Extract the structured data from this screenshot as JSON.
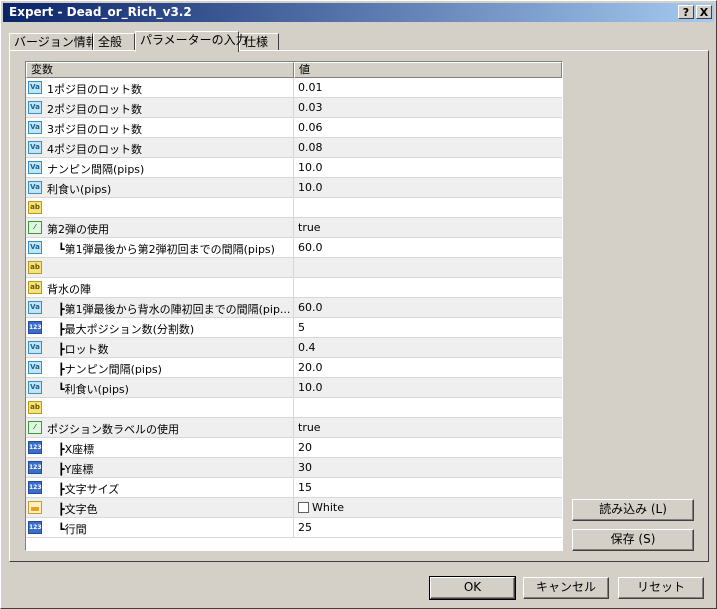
{
  "window": {
    "title": "Expert - Dead_or_Rich_v3.2",
    "help": "?",
    "close": "X"
  },
  "tabs": [
    {
      "label": "バージョン情報"
    },
    {
      "label": "全般"
    },
    {
      "label": "パラメーターの入力"
    },
    {
      "label": "仕様"
    }
  ],
  "grid": {
    "headers": {
      "name": "変数",
      "value": "値"
    },
    "rows": [
      {
        "icon": "va-icon",
        "name": "1ポジ目のロット数",
        "value": "0.01"
      },
      {
        "icon": "va-icon",
        "name": "2ポジ目のロット数",
        "value": "0.03"
      },
      {
        "icon": "va-icon",
        "name": "3ポジ目のロット数",
        "value": "0.06"
      },
      {
        "icon": "va-icon",
        "name": "4ポジ目のロット数",
        "value": "0.08"
      },
      {
        "icon": "va-icon",
        "name": "ナンピン間隔(pips)",
        "value": "10.0"
      },
      {
        "icon": "va-icon",
        "name": "利食い(pips)",
        "value": "10.0"
      },
      {
        "icon": "ab-icon",
        "name": "",
        "value": ""
      },
      {
        "icon": "bool-icon",
        "name": "第2弾の使用",
        "value": "true"
      },
      {
        "icon": "va-icon",
        "name": "┗第1弾最後から第2弾初回までの間隔(pips)",
        "value": "60.0"
      },
      {
        "icon": "ab-icon",
        "name": "",
        "value": ""
      },
      {
        "icon": "ab-icon",
        "name": "背水の陣",
        "value": ""
      },
      {
        "icon": "va-icon",
        "name": "┣第1弾最後から背水の陣初回までの間隔(pip...",
        "value": "60.0"
      },
      {
        "icon": "int-icon",
        "name": "┣最大ポジション数(分割数)",
        "value": "5"
      },
      {
        "icon": "va-icon",
        "name": "┣ロット数",
        "value": "0.4"
      },
      {
        "icon": "va-icon",
        "name": "┣ナンピン間隔(pips)",
        "value": "20.0"
      },
      {
        "icon": "va-icon",
        "name": "┗利食い(pips)",
        "value": "10.0"
      },
      {
        "icon": "ab-icon",
        "name": "",
        "value": ""
      },
      {
        "icon": "bool-icon",
        "name": "ポジション数ラベルの使用",
        "value": "true"
      },
      {
        "icon": "int-icon",
        "name": "┣X座標",
        "value": "20"
      },
      {
        "icon": "int-icon",
        "name": "┣Y座標",
        "value": "30"
      },
      {
        "icon": "int-icon",
        "name": "┣文字サイズ",
        "value": "15"
      },
      {
        "icon": "color-icon",
        "name": "┣文字色",
        "value": "White"
      },
      {
        "icon": "int-icon",
        "name": "┗行間",
        "value": "25"
      }
    ]
  },
  "side_buttons": {
    "load": "読み込み (L)",
    "save": "保存 (S)"
  },
  "footer_buttons": {
    "ok": "OK",
    "cancel": "キャンセル",
    "reset": "リセット"
  },
  "icon_text": {
    "va": "Va",
    "ab": "ab",
    "int": "123"
  }
}
